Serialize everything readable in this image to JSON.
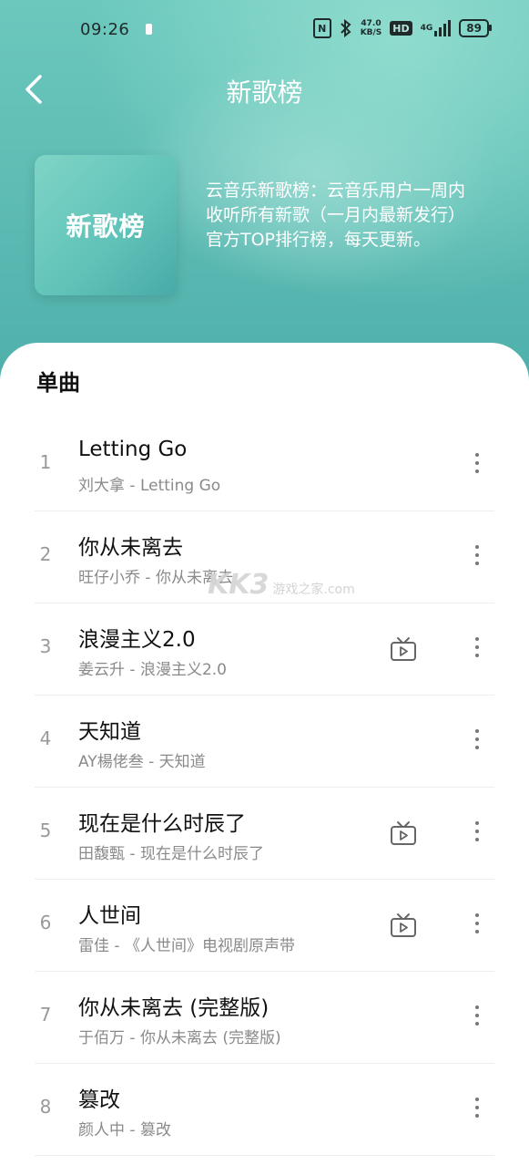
{
  "status_bar": {
    "time": "09:26",
    "nfc_label": "N",
    "speed_value": "47.0",
    "speed_unit": "KB/S",
    "hd_label": "HD",
    "network_label": "4G",
    "battery": "89"
  },
  "header": {
    "title": "新歌榜",
    "cover_text": "新歌榜",
    "description": "云音乐新歌榜：云音乐用户一周内收听所有新歌（一月内最新发行） 官方TOP排行榜，每天更新。"
  },
  "section": {
    "title": "单曲"
  },
  "songs": [
    {
      "index": "1",
      "title": "Letting Go",
      "subtitle": "刘大拿 - Letting Go",
      "has_mv": false
    },
    {
      "index": "2",
      "title": "你从未离去",
      "subtitle": "旺仔小乔 - 你从未离去",
      "has_mv": false
    },
    {
      "index": "3",
      "title": "浪漫主义2.0",
      "subtitle": "姜云升 - 浪漫主义2.0",
      "has_mv": true
    },
    {
      "index": "4",
      "title": "天知道",
      "subtitle": "AY楊佬叁 - 天知道",
      "has_mv": false
    },
    {
      "index": "5",
      "title": "现在是什么时辰了",
      "subtitle": "田馥甄 - 现在是什么时辰了",
      "has_mv": true
    },
    {
      "index": "6",
      "title": "人世间",
      "subtitle": "雷佳 - 《人世间》电视剧原声带",
      "has_mv": true
    },
    {
      "index": "7",
      "title": "你从未离去 (完整版)",
      "subtitle": "于佰万 - 你从未离去 (完整版)",
      "has_mv": false
    },
    {
      "index": "8",
      "title": "篡改",
      "subtitle": "颜人中 - 篡改",
      "has_mv": false
    }
  ],
  "watermark": {
    "logo": "KK3",
    "line1": "游戏之家",
    "line2": ".com"
  },
  "colors": {
    "header_bg": "#5fb9b0",
    "cover_bg": "#6ccabe",
    "mv_icon": "#666666"
  },
  "icons": {
    "back": "chevron-left-icon",
    "more": "more-vertical-icon",
    "mv": "tv-icon"
  }
}
